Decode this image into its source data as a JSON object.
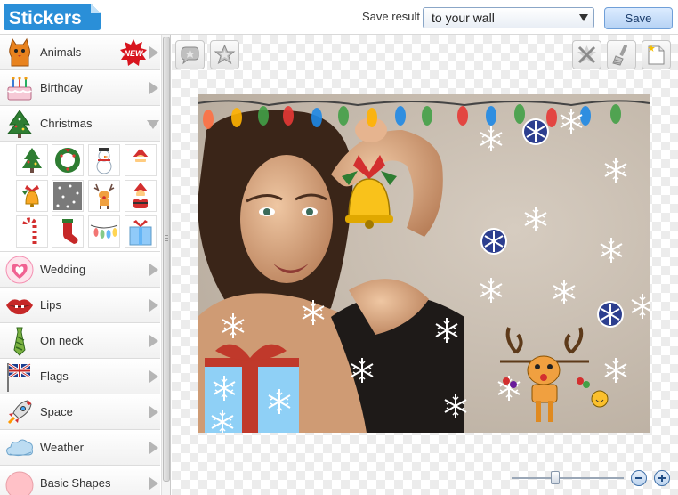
{
  "header": {
    "logo_text": "Stickers",
    "save_result_label": "Save result",
    "destination_value": "to your wall",
    "save_label": "Save"
  },
  "sidebar": {
    "badge_new": "NEW",
    "categories": [
      {
        "label": "Animals",
        "icon": "cat-icon",
        "badge": "NEW",
        "expanded": false
      },
      {
        "label": "Birthday",
        "icon": "cake-icon",
        "expanded": false
      },
      {
        "label": "Christmas",
        "icon": "christmas-tree-icon",
        "expanded": true
      },
      {
        "label": "Wedding",
        "icon": "hearts-icon",
        "expanded": false
      },
      {
        "label": "Lips",
        "icon": "lips-icon",
        "expanded": false
      },
      {
        "label": "On neck",
        "icon": "tie-icon",
        "expanded": false
      },
      {
        "label": "Flags",
        "icon": "uk-flag-icon",
        "expanded": false
      },
      {
        "label": "Space",
        "icon": "rocket-icon",
        "expanded": false
      },
      {
        "label": "Weather",
        "icon": "cloud-icon",
        "expanded": false
      },
      {
        "label": "Basic Shapes",
        "icon": "circle-shape-icon",
        "expanded": false
      }
    ],
    "christmas_stickers": [
      "christmas-tree-sticker",
      "wreath-sticker",
      "snowman-sticker",
      "santa-sticker",
      "bell-sticker",
      "snow-tile-sticker",
      "reindeer-sticker",
      "santa-2-sticker",
      "candy-cane-sticker",
      "stocking-sticker",
      "lights-sticker",
      "gift-box-sticker"
    ]
  },
  "toolbar": {
    "left_tools": [
      "star-speech-icon",
      "star-icon"
    ],
    "right_tools": [
      "clear-icon",
      "brush-icon",
      "new-page-icon"
    ]
  },
  "zoom": {
    "level": 0.41
  },
  "colors": {
    "accent": "#3e6fa8",
    "logo_blue": "#2a8fd8",
    "save_button": "#b6d2f4"
  }
}
